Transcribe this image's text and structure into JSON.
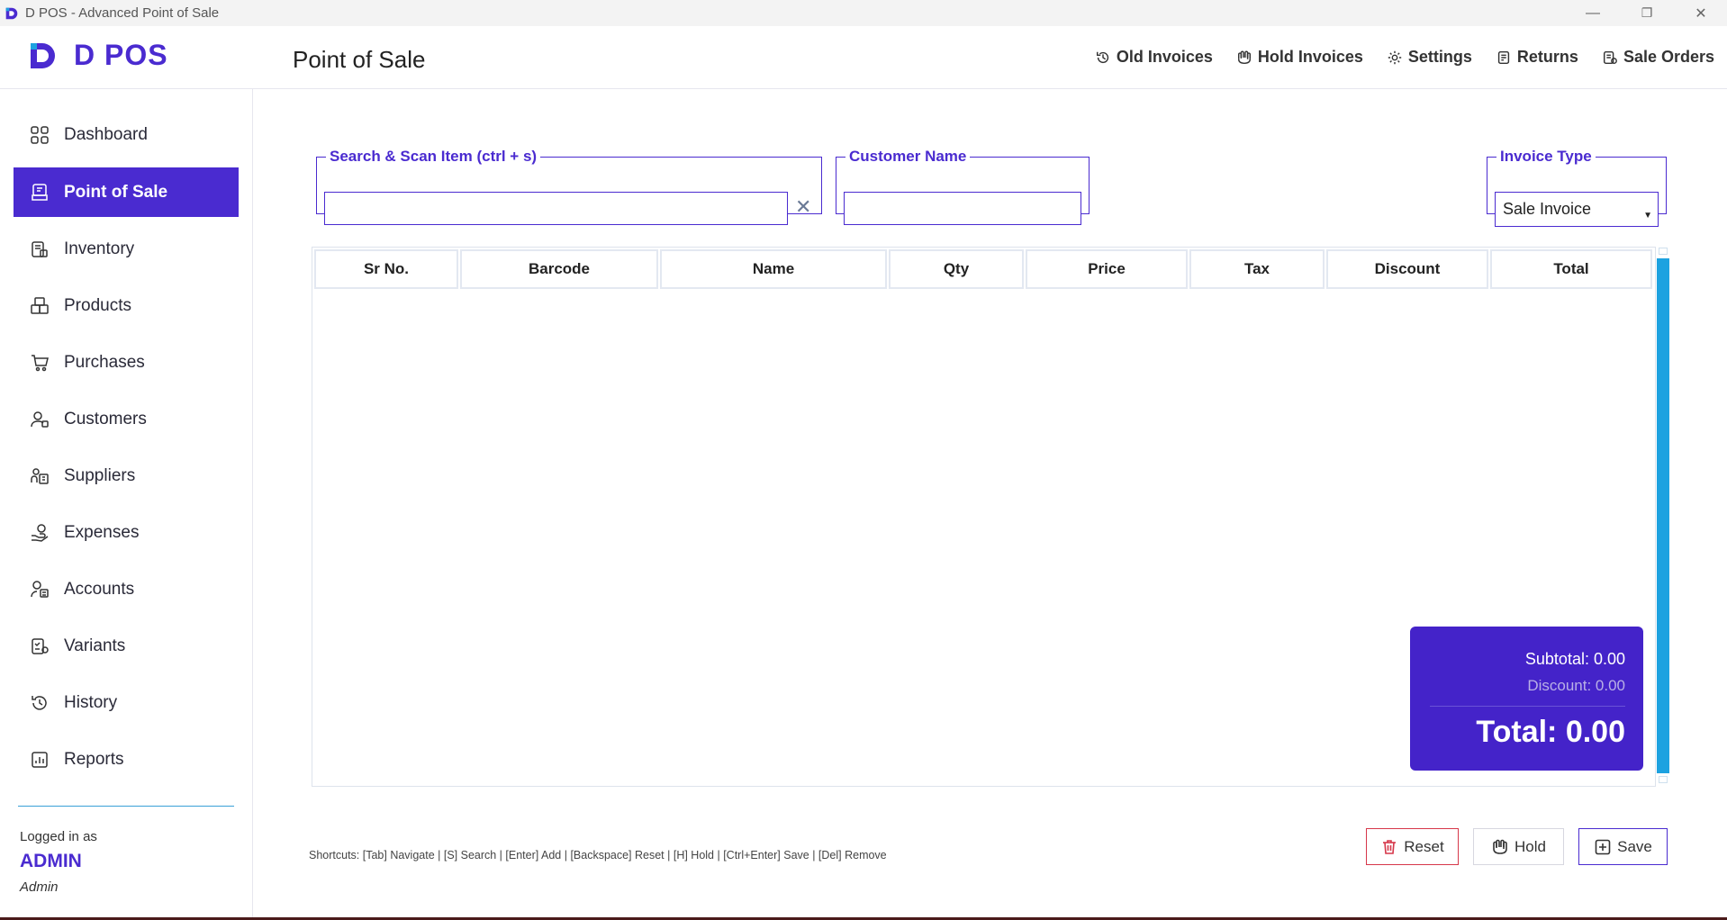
{
  "window": {
    "title": "D POS - Advanced Point of Sale",
    "controls": {
      "minimize": "—",
      "restore": "❐",
      "close": "✕"
    }
  },
  "brand": {
    "name": "D POS",
    "color": "#4a2bd0"
  },
  "header": {
    "page_title": "Point of Sale",
    "nav": [
      {
        "label": "Old Invoices",
        "icon": "history-icon"
      },
      {
        "label": "Hold Invoices",
        "icon": "hand-hold-icon"
      },
      {
        "label": "Settings",
        "icon": "gear-icon"
      },
      {
        "label": "Returns",
        "icon": "return-document-icon"
      },
      {
        "label": "Sale Orders",
        "icon": "order-document-icon"
      }
    ]
  },
  "sidebar": {
    "items": [
      {
        "label": "Dashboard",
        "icon": "dashboard-grid-icon",
        "active": false
      },
      {
        "label": "Point of Sale",
        "icon": "pos-terminal-icon",
        "active": true
      },
      {
        "label": "Inventory",
        "icon": "inventory-icon",
        "active": false
      },
      {
        "label": "Products",
        "icon": "products-box-icon",
        "active": false
      },
      {
        "label": "Purchases",
        "icon": "cart-icon",
        "active": false
      },
      {
        "label": "Customers",
        "icon": "customer-icon",
        "active": false
      },
      {
        "label": "Suppliers",
        "icon": "supplier-icon",
        "active": false
      },
      {
        "label": "Expenses",
        "icon": "expense-hand-icon",
        "active": false
      },
      {
        "label": "Accounts",
        "icon": "accounts-icon",
        "active": false
      },
      {
        "label": "Variants",
        "icon": "variants-icon",
        "active": false
      },
      {
        "label": "History",
        "icon": "history-icon",
        "active": false
      },
      {
        "label": "Reports",
        "icon": "reports-chart-icon",
        "active": false
      }
    ],
    "logged_in_label": "Logged in as",
    "username": "ADMIN",
    "role": "Admin"
  },
  "form": {
    "search": {
      "legend": "Search & Scan Item (ctrl + s)",
      "value": "",
      "placeholder": "",
      "clear": "✕"
    },
    "customer": {
      "legend": "Customer Name",
      "value": "",
      "placeholder": ""
    },
    "invoice_type": {
      "legend": "Invoice Type",
      "selected": "Sale Invoice"
    }
  },
  "table": {
    "columns": [
      "Sr No.",
      "Barcode",
      "Name",
      "Qty",
      "Price",
      "Tax",
      "Discount",
      "Total"
    ],
    "rows": []
  },
  "totals": {
    "subtotal": "Subtotal: 0.00",
    "discount": "Discount: 0.00",
    "total": "Total: 0.00"
  },
  "shortcuts": "Shortcuts: [Tab] Navigate | [S] Search | [Enter] Add | [Backspace] Reset | [H] Hold | [Ctrl+Enter] Save | [Del] Remove",
  "actions": {
    "reset": "Reset",
    "hold": "Hold",
    "save": "Save"
  },
  "colors": {
    "accent": "#4a2bd0",
    "scrollbar": "#1da2e0",
    "reset_border": "#d6374a"
  }
}
